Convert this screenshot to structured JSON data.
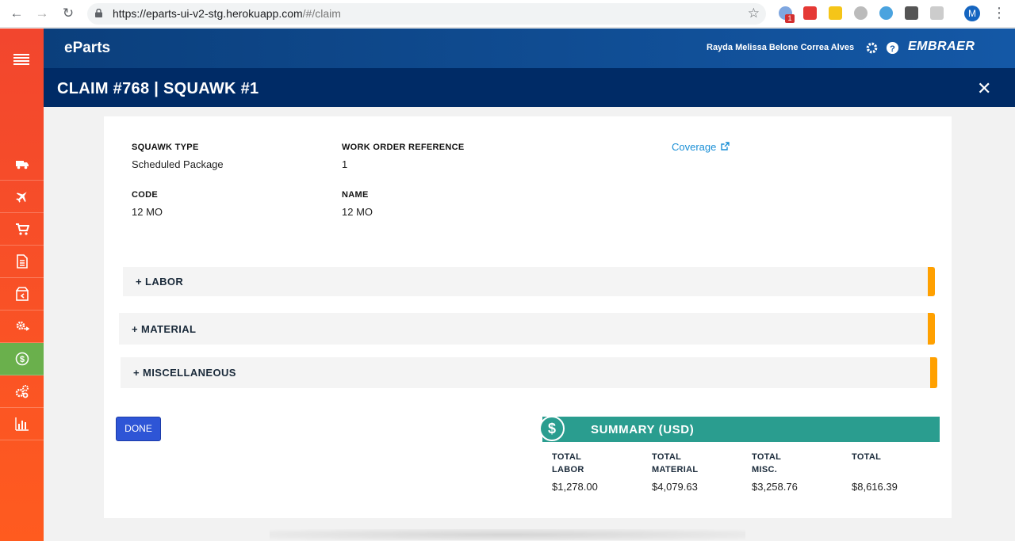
{
  "browser": {
    "url_host": "https://eparts-ui-v2-stg.herokuapp.com",
    "url_path": "/#/claim",
    "ext_badge": "1",
    "profile_initial": "M"
  },
  "app": {
    "brand": "eParts",
    "user_name": "Rayda Melissa Belone Correa Alves",
    "company_logo": "EMBRAER"
  },
  "page": {
    "title": "CLAIM #768 | SQUAWK #1"
  },
  "sidebar": {
    "items": [
      {
        "icon": "truck-icon"
      },
      {
        "icon": "airplane-icon"
      },
      {
        "icon": "cart-icon"
      },
      {
        "icon": "document-icon"
      },
      {
        "icon": "package-return-icon"
      },
      {
        "icon": "gear-exchange-icon"
      },
      {
        "icon": "dollar-circle-icon",
        "active": true
      },
      {
        "icon": "gears-icon"
      },
      {
        "icon": "bar-chart-icon"
      }
    ]
  },
  "details": {
    "squawk_type_label": "SQUAWK TYPE",
    "squawk_type_value": "Scheduled Package",
    "work_order_label": "WORK ORDER REFERENCE",
    "work_order_value": "1",
    "coverage_link": "Coverage",
    "code_label": "CODE",
    "code_value": "12 MO",
    "name_label": "NAME",
    "name_value": "12 MO"
  },
  "sections": [
    {
      "label": "+ LABOR"
    },
    {
      "label": "+ MATERIAL"
    },
    {
      "label": "+ MISCELLANEOUS"
    }
  ],
  "actions": {
    "done_label": "DONE"
  },
  "summary": {
    "title": "SUMMARY (USD)",
    "currency_symbol": "$",
    "columns": [
      {
        "label_line1": "TOTAL",
        "label_line2": "LABOR",
        "value": "$1,278.00"
      },
      {
        "label_line1": "TOTAL",
        "label_line2": "MATERIAL",
        "value": "$4,079.63"
      },
      {
        "label_line1": "TOTAL",
        "label_line2": "MISC.",
        "value": "$3,258.76"
      },
      {
        "label_line1": "TOTAL",
        "label_line2": "",
        "value": "$8,616.39"
      }
    ]
  },
  "colors": {
    "sidebar": "#f2462e",
    "header": "#0b3f7c",
    "title_bar": "#002b66",
    "accent_orange": "#ffa000",
    "summary_teal": "#2a9d8f",
    "done_blue": "#2e55d6",
    "active_green": "#6ab04c",
    "link_blue": "#1a8fd6"
  }
}
